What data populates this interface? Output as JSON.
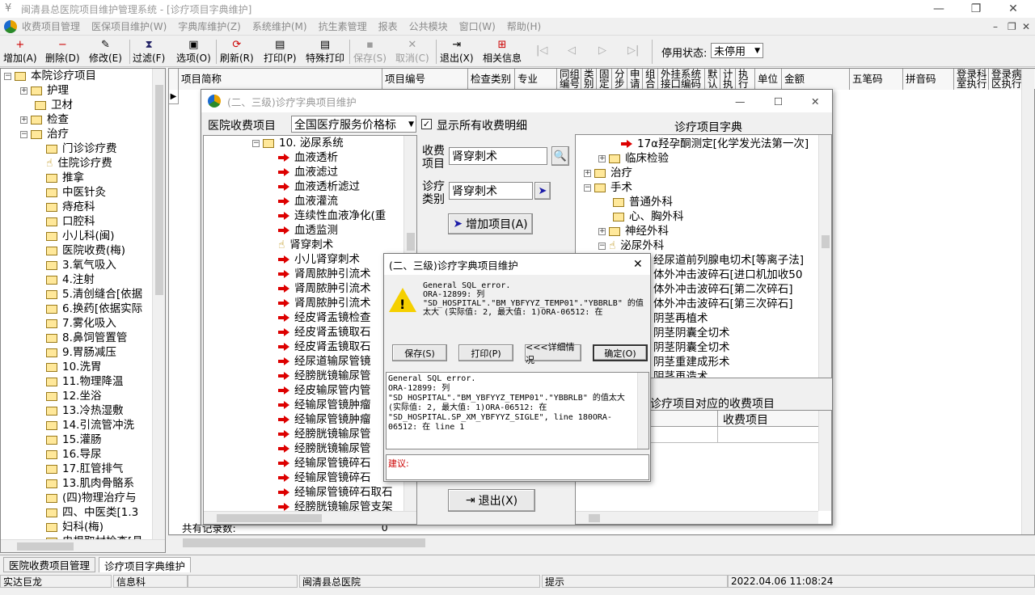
{
  "window": {
    "title": "闽清县总医院项目维护管理系统 - [诊疗项目字典维护]",
    "min": "—",
    "restore": "❐",
    "close": "✕"
  },
  "menu": [
    "收费项目管理",
    "医保项目维护(W)",
    "字典库维护(Z)",
    "系统维护(M)",
    "抗生素管理",
    "报表",
    "公共模块",
    "窗口(W)",
    "帮助(H)"
  ],
  "mdi_controls": {
    "min": "–",
    "restore": "❐",
    "close": "✕"
  },
  "toolbar": {
    "buttons": [
      "增加(A)",
      "删除(D)",
      "修改(E)",
      "过滤(F)",
      "选项(O)",
      "刷新(R)",
      "打印(P)",
      "特殊打印",
      "保存(S)",
      "取消(C)",
      "退出(X)",
      "相关信息"
    ],
    "status_label": "停用状态:",
    "status_value": "未停用"
  },
  "left_tree": {
    "root": "本院诊疗项目",
    "items": [
      "护理",
      "卫材",
      "检查",
      "治疗",
      "门诊诊疗费",
      "住院诊疗费",
      "推拿",
      "中医针灸",
      "痔疮科",
      "口腔科",
      "小儿科(闽)",
      "医院收费(梅)",
      "3.氧气吸入",
      "4.注射",
      "5.清创缝合[依据",
      "6.换药[依据实际",
      "7.雾化吸入",
      "8.鼻饲管置管",
      "9.胃肠减压",
      "10.洗胃",
      "11.物理降温",
      "12.坐浴",
      "13.冷热湿敷",
      "14.引流管冲洗",
      "15.灌肠",
      "16.导尿",
      "17.肛管排气",
      "13.肌肉骨骼系",
      "(四)物理治疗与",
      "四、中医类[1.3",
      "妇科(梅)",
      "电根取材检查[具"
    ]
  },
  "grid": {
    "headers": [
      "项目简称",
      "项目编号",
      "检查类别",
      "专业",
      "同组编号",
      "类别",
      "固定",
      "分步",
      "申请",
      "组合",
      "外挂系统接口编码",
      "默认",
      "计执",
      "执行",
      "单位",
      "金额",
      "五笔码",
      "拼音码",
      "登录科室执行",
      "登录病区执行"
    ],
    "footer_label": "共有记录数:",
    "footer_value": "0"
  },
  "dict_window": {
    "title": "(二、三级)诊疗字典项目维护",
    "fee_label": "医院收费项目",
    "fee_select": "全国医疗服务价格标",
    "show_all": "显示所有收费明细",
    "right_title": "诊疗项目字典",
    "fee_item_label": "收费项目",
    "fee_item_value": "肾穿刺术",
    "cat_label": "诊疗类别",
    "cat_value": "肾穿刺术",
    "add_btn": "增加项目(A)",
    "exit_btn": "退出(X)",
    "lower_title": "诊疗项目对应的收费项目",
    "lower_col": "收费项目"
  },
  "fee_tree": {
    "group": "10. 泌尿系统",
    "items": [
      "血液透析",
      "血液滤过",
      "血液透析滤过",
      "血液灌流",
      "连续性血液净化(重",
      "血透监测",
      "肾穿刺术",
      "小儿肾穿刺术",
      "肾周脓肿引流术",
      "肾周脓肿引流术",
      "肾周脓肿引流术",
      "经皮肾盂镜检查",
      "经皮肾盂镜取石",
      "经皮肾盂镜取石",
      "经尿道输尿管镜",
      "经膀胱镜输尿管",
      "经皮输尿管内管",
      "经输尿管镜肿瘤",
      "经输尿管镜肿瘤",
      "经膀胱镜输尿管",
      "经膀胱镜输尿管",
      "经输尿管镜碎石",
      "经输尿管镜碎石",
      "经输尿管镜碎石取石",
      "经膀胱镜输尿管支架"
    ]
  },
  "dict_tree": {
    "items": [
      "17α羟孕酮测定[化学发光法第一次]",
      "临床检验",
      "治疗",
      "手术",
      "普通外科",
      "心、胸外科",
      "神经外科",
      "泌尿外科",
      "经尿道前列腺电切术[等离子法]",
      "体外冲击波碎石[进口机加收50",
      "体外冲击波碎石[第二次碎石]",
      "体外冲击波碎石[第三次碎石]",
      "阴茎再植术",
      "阴茎阴囊全切术",
      "阴茎阴囊全切术",
      "阴茎重建成形术",
      "阴茎再造术"
    ]
  },
  "error_dialog": {
    "title": "(二、三级)诊疗字典项目维护",
    "message": "General SQL error.\nORA-12899: 列\n\"SD_HOSPITAL\".\"BM_YBFYYZ_TEMP01\".\"YBBRLB\" 的值\n太大 (实际值: 2, 最大值: 1)ORA-06512: 在",
    "buttons": [
      "保存(S)",
      "打印(P)",
      "<<<详细情况",
      "确定(O)"
    ],
    "detail": "General SQL error.\nORA-12899: 列\n\"SD_HOSPITAL\".\"BM_YBFYYZ_TEMP01\".\"YBBRLB\" 的值太大\n(实际值: 2, 最大值: 1)ORA-06512: 在\n\"SD_HOSPITAL.SP_XM_YBFYYZ_SIGLE\", line 180ORA-\n06512: 在 line 1",
    "suggest_label": "建议:"
  },
  "tabs": [
    "医院收费项目管理",
    "诊疗项目字典维护"
  ],
  "statusbar": [
    "实达巨龙",
    "信息科",
    "闽清县总医院",
    "提示",
    "2022.04.06  11:08:24"
  ]
}
